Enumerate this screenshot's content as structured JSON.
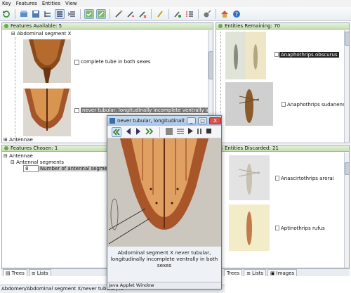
{
  "menu": [
    "Key",
    "Features",
    "Entities",
    "View"
  ],
  "toolbar": {
    "buttons": [
      "restart-icon",
      "open-icon",
      "save-icon",
      "tree-icon",
      "list-icon",
      "indent-icon",
      "best-icon",
      "separate-icon",
      "tool-a-icon",
      "tool-b-icon",
      "tool-c-icon",
      "tool-d-icon",
      "tool-e-icon",
      "tool-f-icon",
      "home-icon",
      "help-icon"
    ]
  },
  "features_available": {
    "header": "Features Available: 5",
    "group": "Abdominal segment X",
    "state1": "complete tube in both sexes",
    "state2": "never tubular, longitudinally incomplete ventrally in both sexes",
    "group2": "Antennae"
  },
  "features_chosen": {
    "header": "Features Chosen: 1",
    "root": "Antennae",
    "child": "Antennal segments",
    "value": "8",
    "value_label": "Number of antennal segments"
  },
  "entities_remaining": {
    "header": "Entities Remaining: 70",
    "items": [
      "Anaphothrips obscurus",
      "Anaphothrips sudanensis"
    ]
  },
  "entities_discarded": {
    "header": "Entities Discarded: 21",
    "items": [
      "Anascirtothrips arorai",
      "Aptinothrips rufus"
    ]
  },
  "left_tabs": [
    "Trees",
    "Lists"
  ],
  "right_tabs": [
    "Trees",
    "Lists",
    "Images"
  ],
  "status": "Abdomen/Abdominal segment X/never tubular, lo",
  "popup": {
    "title": "never tubular, longitudinally incomplete v...",
    "caption": "Abdominal segment X never tubular, longitudinally incomplete ventrally in both sexes",
    "footer": "Java Applet Window",
    "min": "_",
    "max": "□",
    "close": "X"
  },
  "colors": {
    "panel_header": "#c7dfb4",
    "title_bar": "#a9c6e6",
    "selection": "#222222"
  }
}
